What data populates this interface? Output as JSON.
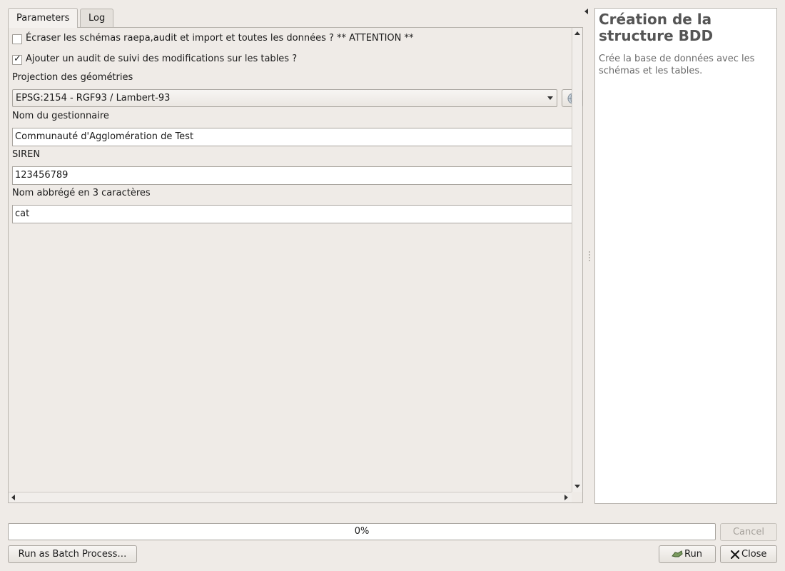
{
  "tabs": [
    {
      "label": "Parameters"
    },
    {
      "label": "Log"
    }
  ],
  "params": {
    "overwrite": {
      "label": "Écraser les schémas raepa,audit et import et toutes les données ? ** ATTENTION **",
      "checked": false
    },
    "audit": {
      "label": "Ajouter un audit de suivi des modifications sur les tables ?",
      "checked": true,
      "mark": "✓"
    },
    "projection": {
      "label": "Projection des géométries",
      "value": "EPSG:2154 - RGF93 / Lambert-93"
    },
    "manager": {
      "label": "Nom du gestionnaire",
      "value": "Communauté d'Agglomération de Test"
    },
    "siren": {
      "label": "SIREN",
      "value": "123456789"
    },
    "abbrev": {
      "label": "Nom abbrégé en 3 caractères",
      "value": "cat"
    }
  },
  "help": {
    "title": "Création de la structure BDD",
    "description": "Crée la base de données avec les schémas et les tables."
  },
  "progress": {
    "text": "0%",
    "value": 0
  },
  "buttons": {
    "cancel": "Cancel",
    "batch": "Run as Batch Process…",
    "run": "Run",
    "close": "Close"
  },
  "icons": {
    "collapse": "collapse-arrow-icon",
    "crs": "globe-icon",
    "run": "run-icon",
    "close": "close-icon"
  }
}
